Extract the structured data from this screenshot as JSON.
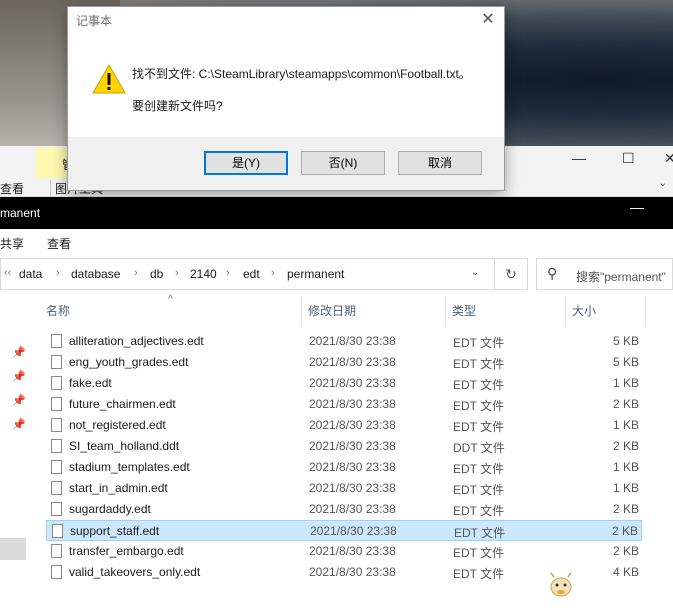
{
  "dialog": {
    "title": "记事本",
    "close_glyph": "✕",
    "message_line1": "找不到文件: C:\\SteamLibrary\\steamapps\\common\\Football.txt。",
    "message_line2": "要创建新文件吗?",
    "buttons": {
      "yes": "是(Y)",
      "no": "否(N)",
      "cancel": "取消"
    }
  },
  "ribbon_bg": {
    "context_tab_fragment": "管",
    "view_tab": "查看",
    "picture_tools": "图片工具"
  },
  "window": {
    "title": "manent",
    "min_glyph": "—",
    "max_glyph": "☐",
    "close_glyph": "✕"
  },
  "menubar": {
    "share": "共享",
    "view": "查看"
  },
  "breadcrumb": [
    "data",
    "database",
    "db",
    "2140",
    "edt",
    "permanent"
  ],
  "search": {
    "placeholder": "搜索\"permanent\""
  },
  "columns": {
    "name": "名称",
    "date": "修改日期",
    "type": "类型",
    "size": "大小"
  },
  "files": [
    {
      "name": "alliteration_adjectives.edt",
      "date": "2021/8/30 23:38",
      "type": "EDT 文件",
      "size": "5 KB"
    },
    {
      "name": "eng_youth_grades.edt",
      "date": "2021/8/30 23:38",
      "type": "EDT 文件",
      "size": "5 KB"
    },
    {
      "name": "fake.edt",
      "date": "2021/8/30 23:38",
      "type": "EDT 文件",
      "size": "1 KB"
    },
    {
      "name": "future_chairmen.edt",
      "date": "2021/8/30 23:38",
      "type": "EDT 文件",
      "size": "2 KB"
    },
    {
      "name": "not_registered.edt",
      "date": "2021/8/30 23:38",
      "type": "EDT 文件",
      "size": "1 KB"
    },
    {
      "name": "SI_team_holland.ddt",
      "date": "2021/8/30 23:38",
      "type": "DDT 文件",
      "size": "2 KB"
    },
    {
      "name": "stadium_templates.edt",
      "date": "2021/8/30 23:38",
      "type": "EDT 文件",
      "size": "1 KB"
    },
    {
      "name": "start_in_admin.edt",
      "date": "2021/8/30 23:38",
      "type": "EDT 文件",
      "size": "1 KB"
    },
    {
      "name": "sugardaddy.edt",
      "date": "2021/8/30 23:38",
      "type": "EDT 文件",
      "size": "2 KB"
    },
    {
      "name": "support_staff.edt",
      "date": "2021/8/30 23:38",
      "type": "EDT 文件",
      "size": "2 KB"
    },
    {
      "name": "transfer_embargo.edt",
      "date": "2021/8/30 23:38",
      "type": "EDT 文件",
      "size": "2 KB"
    },
    {
      "name": "valid_takeovers_only.edt",
      "date": "2021/8/30 23:38",
      "type": "EDT 文件",
      "size": "4 KB"
    }
  ],
  "selected_file": "support_staff.edt",
  "colors": {
    "accent": "#0078d7",
    "selection": "#cce8ff",
    "warning": "#ffd400"
  }
}
